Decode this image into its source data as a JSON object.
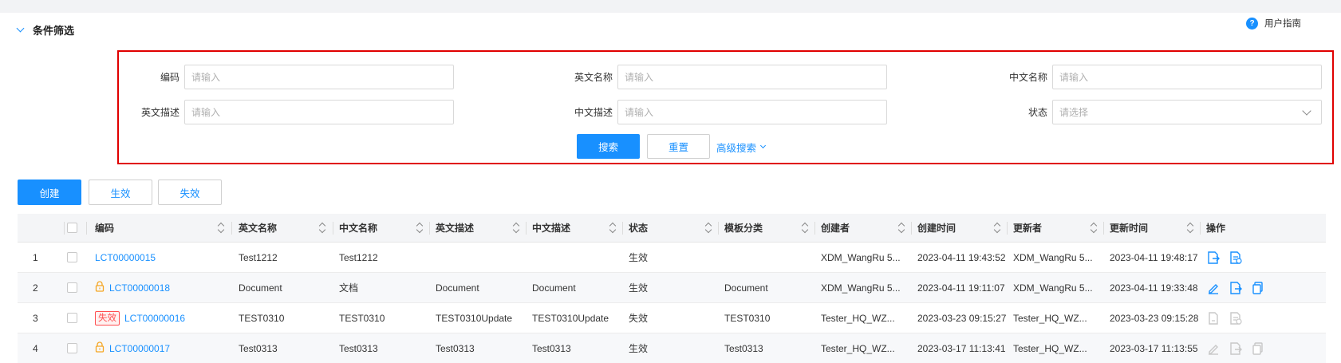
{
  "header": {
    "section_title": "条件筛选",
    "user_guide": "用户指南"
  },
  "filter": {
    "fields": [
      {
        "label": "编码",
        "placeholder": "请输入"
      },
      {
        "label": "英文名称",
        "placeholder": "请输入"
      },
      {
        "label": "中文名称",
        "placeholder": "请输入"
      },
      {
        "label": "英文描述",
        "placeholder": "请输入"
      },
      {
        "label": "中文描述",
        "placeholder": "请输入"
      },
      {
        "label": "状态",
        "placeholder": "请选择"
      }
    ],
    "search_label": "搜索",
    "reset_label": "重置",
    "advanced_label": "高级搜索"
  },
  "actions": {
    "create_label": "创建",
    "enable_label": "生效",
    "disable_label": "失效"
  },
  "table": {
    "columns": [
      "编码",
      "英文名称",
      "中文名称",
      "英文描述",
      "中文描述",
      "状态",
      "模板分类",
      "创建者",
      "创建时间",
      "更新者",
      "更新时间",
      "操作"
    ],
    "rows": [
      {
        "index": "1",
        "code": "LCT00000015",
        "badge": "",
        "locked": false,
        "en_name": "Test1212",
        "cn_name": "Test1212",
        "en_desc": "",
        "cn_desc": "",
        "status": "生效",
        "category": "",
        "creator": "XDM_WangRu 5...",
        "created": "2023-04-11 19:43:52",
        "updater": "XDM_WangRu 5...",
        "updated": "2023-04-11 19:48:17",
        "ops": [
          "export-active",
          "doc-active"
        ]
      },
      {
        "index": "2",
        "code": "LCT00000018",
        "badge": "",
        "locked": true,
        "en_name": "Document",
        "cn_name": "文档",
        "en_desc": "Document",
        "cn_desc": "Document",
        "status": "生效",
        "category": "Document",
        "creator": "XDM_WangRu 5...",
        "created": "2023-04-11 19:11:07",
        "updater": "XDM_WangRu 5...",
        "updated": "2023-04-11 19:33:48",
        "ops": [
          "edit-active",
          "export-active",
          "copy-active"
        ]
      },
      {
        "index": "3",
        "code": "LCT00000016",
        "badge": "失效",
        "locked": false,
        "en_name": "TEST0310",
        "cn_name": "TEST0310",
        "en_desc": "TEST0310Update",
        "cn_desc": "TEST0310Update",
        "status": "失效",
        "category": "TEST0310",
        "creator": "Tester_HQ_WZ...",
        "created": "2023-03-23 09:15:27",
        "updater": "Tester_HQ_WZ...",
        "updated": "2023-03-23 09:15:28",
        "ops": [
          "file-disabled",
          "doc-disabled"
        ]
      },
      {
        "index": "4",
        "code": "LCT00000017",
        "badge": "",
        "locked": true,
        "en_name": "Test0313",
        "cn_name": "Test0313",
        "en_desc": "Test0313",
        "cn_desc": "Test0313",
        "status": "生效",
        "category": "Test0313",
        "creator": "Tester_HQ_WZ...",
        "created": "2023-03-17 11:13:41",
        "updater": "Tester_HQ_WZ...",
        "updated": "2023-03-17 11:13:55",
        "ops": [
          "edit-disabled",
          "export-disabled",
          "copy-disabled"
        ]
      }
    ]
  },
  "colors": {
    "primary": "#1890ff",
    "danger": "#ff4d4f",
    "highlight_border": "#e00000",
    "disabled_icon": "#c8c8c8"
  }
}
